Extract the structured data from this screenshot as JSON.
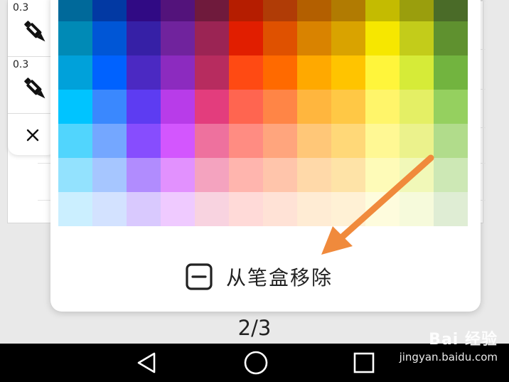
{
  "pen_toolbar": {
    "pens": [
      {
        "size": "0.3",
        "icon": "pen-icon"
      },
      {
        "size": "0.3",
        "icon": "pen-icon"
      }
    ],
    "close_icon": "close-icon"
  },
  "palette": {
    "columns": 12,
    "rows": [
      [
        "#00699a",
        "#0239a3",
        "#300a84",
        "#53137b",
        "#6f1a3c",
        "#b51d00",
        "#b03c06",
        "#b35f00",
        "#b17b02",
        "#c4bb01",
        "#9a9e0d",
        "#4a6b28"
      ],
      [
        "#008ab6",
        "#0056d6",
        "#3620a6",
        "#70239d",
        "#9b2454",
        "#e11e00",
        "#df5100",
        "#d98300",
        "#d9a300",
        "#f6e700",
        "#c3cc1a",
        "#5f912f"
      ],
      [
        "#00a1da",
        "#0062ff",
        "#4b29c2",
        "#8c2bbf",
        "#b72c5f",
        "#ff4a13",
        "#ff6a00",
        "#ffa900",
        "#ffc400",
        "#fff53b",
        "#d6eb38",
        "#72b43f"
      ],
      [
        "#00c4ff",
        "#3a88fe",
        "#5d3cf2",
        "#b83ce9",
        "#e33d7d",
        "#ff6550",
        "#ff8546",
        "#ffb63e",
        "#ffc845",
        "#fff56a",
        "#e4ef65",
        "#95d05f"
      ],
      [
        "#51d5fd",
        "#74a7ff",
        "#874dfe",
        "#d356fe",
        "#ee719e",
        "#ff8c82",
        "#ffa57d",
        "#ffc778",
        "#ffd878",
        "#fff894",
        "#ebf28c",
        "#b1dc8b"
      ],
      [
        "#93e2fe",
        "#a6c6ff",
        "#b18cfe",
        "#e291fe",
        "#f4a3bf",
        "#ffb5ae",
        "#ffc5ab",
        "#ffd9a9",
        "#fee3a7",
        "#fefbb8",
        "#f1f8b8",
        "#cde8b5"
      ],
      [
        "#cbefff",
        "#d3e2ff",
        "#d9c9fe",
        "#efcaff",
        "#f8d3e0",
        "#ffdad8",
        "#ffe2d6",
        "#ffecd4",
        "#fff1d5",
        "#fefcdd",
        "#f6fadb",
        "#dfedd4"
      ]
    ],
    "arrow_color": "#f08a3c"
  },
  "remove_button": {
    "label": "从笔盒移除",
    "icon": "minus-box-icon"
  },
  "page_indicator": "2/3",
  "nav_bar": {
    "back_icon": "back-triangle-icon",
    "home_icon": "home-circle-icon",
    "recents_icon": "recents-square-icon"
  },
  "watermark": {
    "logo": "Bai 经验",
    "url": "jingyan.baidu.com"
  }
}
